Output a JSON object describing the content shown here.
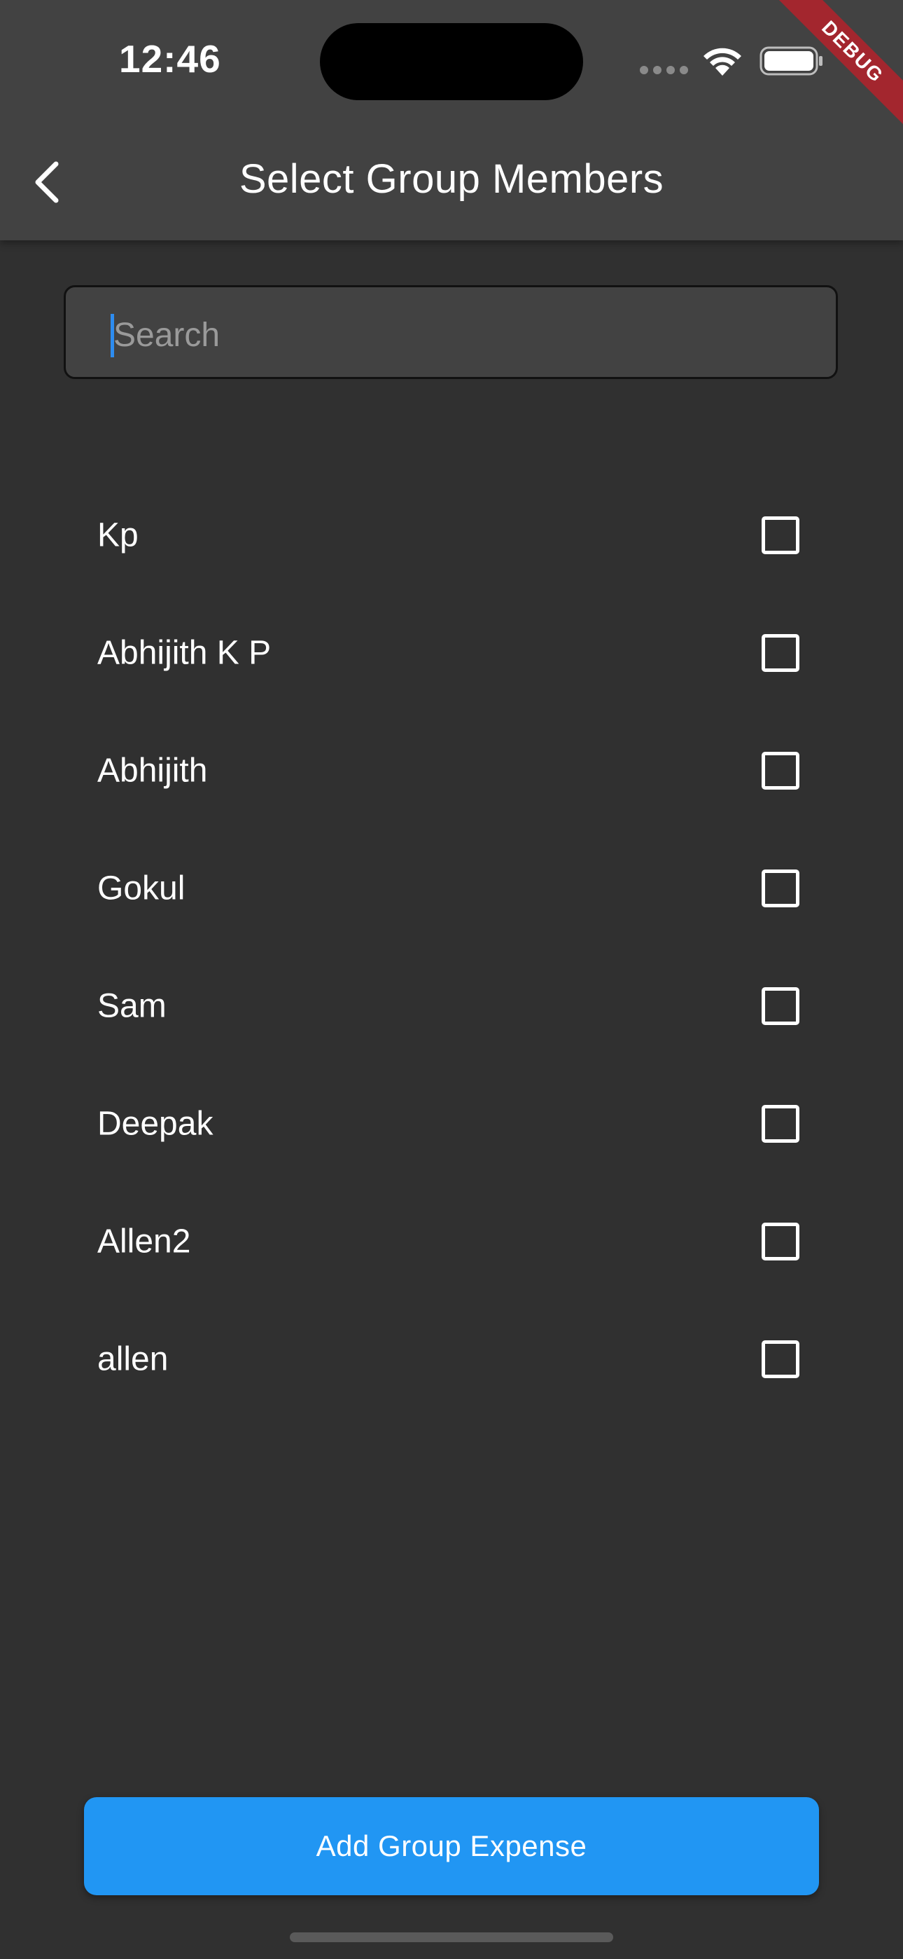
{
  "status_bar": {
    "time": "12:46",
    "icons": [
      "cellular-signal-icon",
      "wifi-icon",
      "battery-icon"
    ]
  },
  "debug_banner": "DEBUG",
  "app_bar": {
    "back_icon": "chevron-left-icon",
    "title": "Select Group Members"
  },
  "search": {
    "placeholder": "Search",
    "value": ""
  },
  "members": [
    {
      "name": "Kp",
      "checked": false
    },
    {
      "name": "Abhijith K P",
      "checked": false
    },
    {
      "name": "Abhijith",
      "checked": false
    },
    {
      "name": "Gokul",
      "checked": false
    },
    {
      "name": "Sam",
      "checked": false
    },
    {
      "name": "Deepak",
      "checked": false
    },
    {
      "name": "Allen2",
      "checked": false
    },
    {
      "name": "allen",
      "checked": false
    }
  ],
  "primary_action": {
    "label": "Add Group Expense"
  },
  "colors": {
    "background": "#303030",
    "app_bar": "#424242",
    "accent": "#2196f3",
    "debug_ribbon": "#a3262e"
  }
}
